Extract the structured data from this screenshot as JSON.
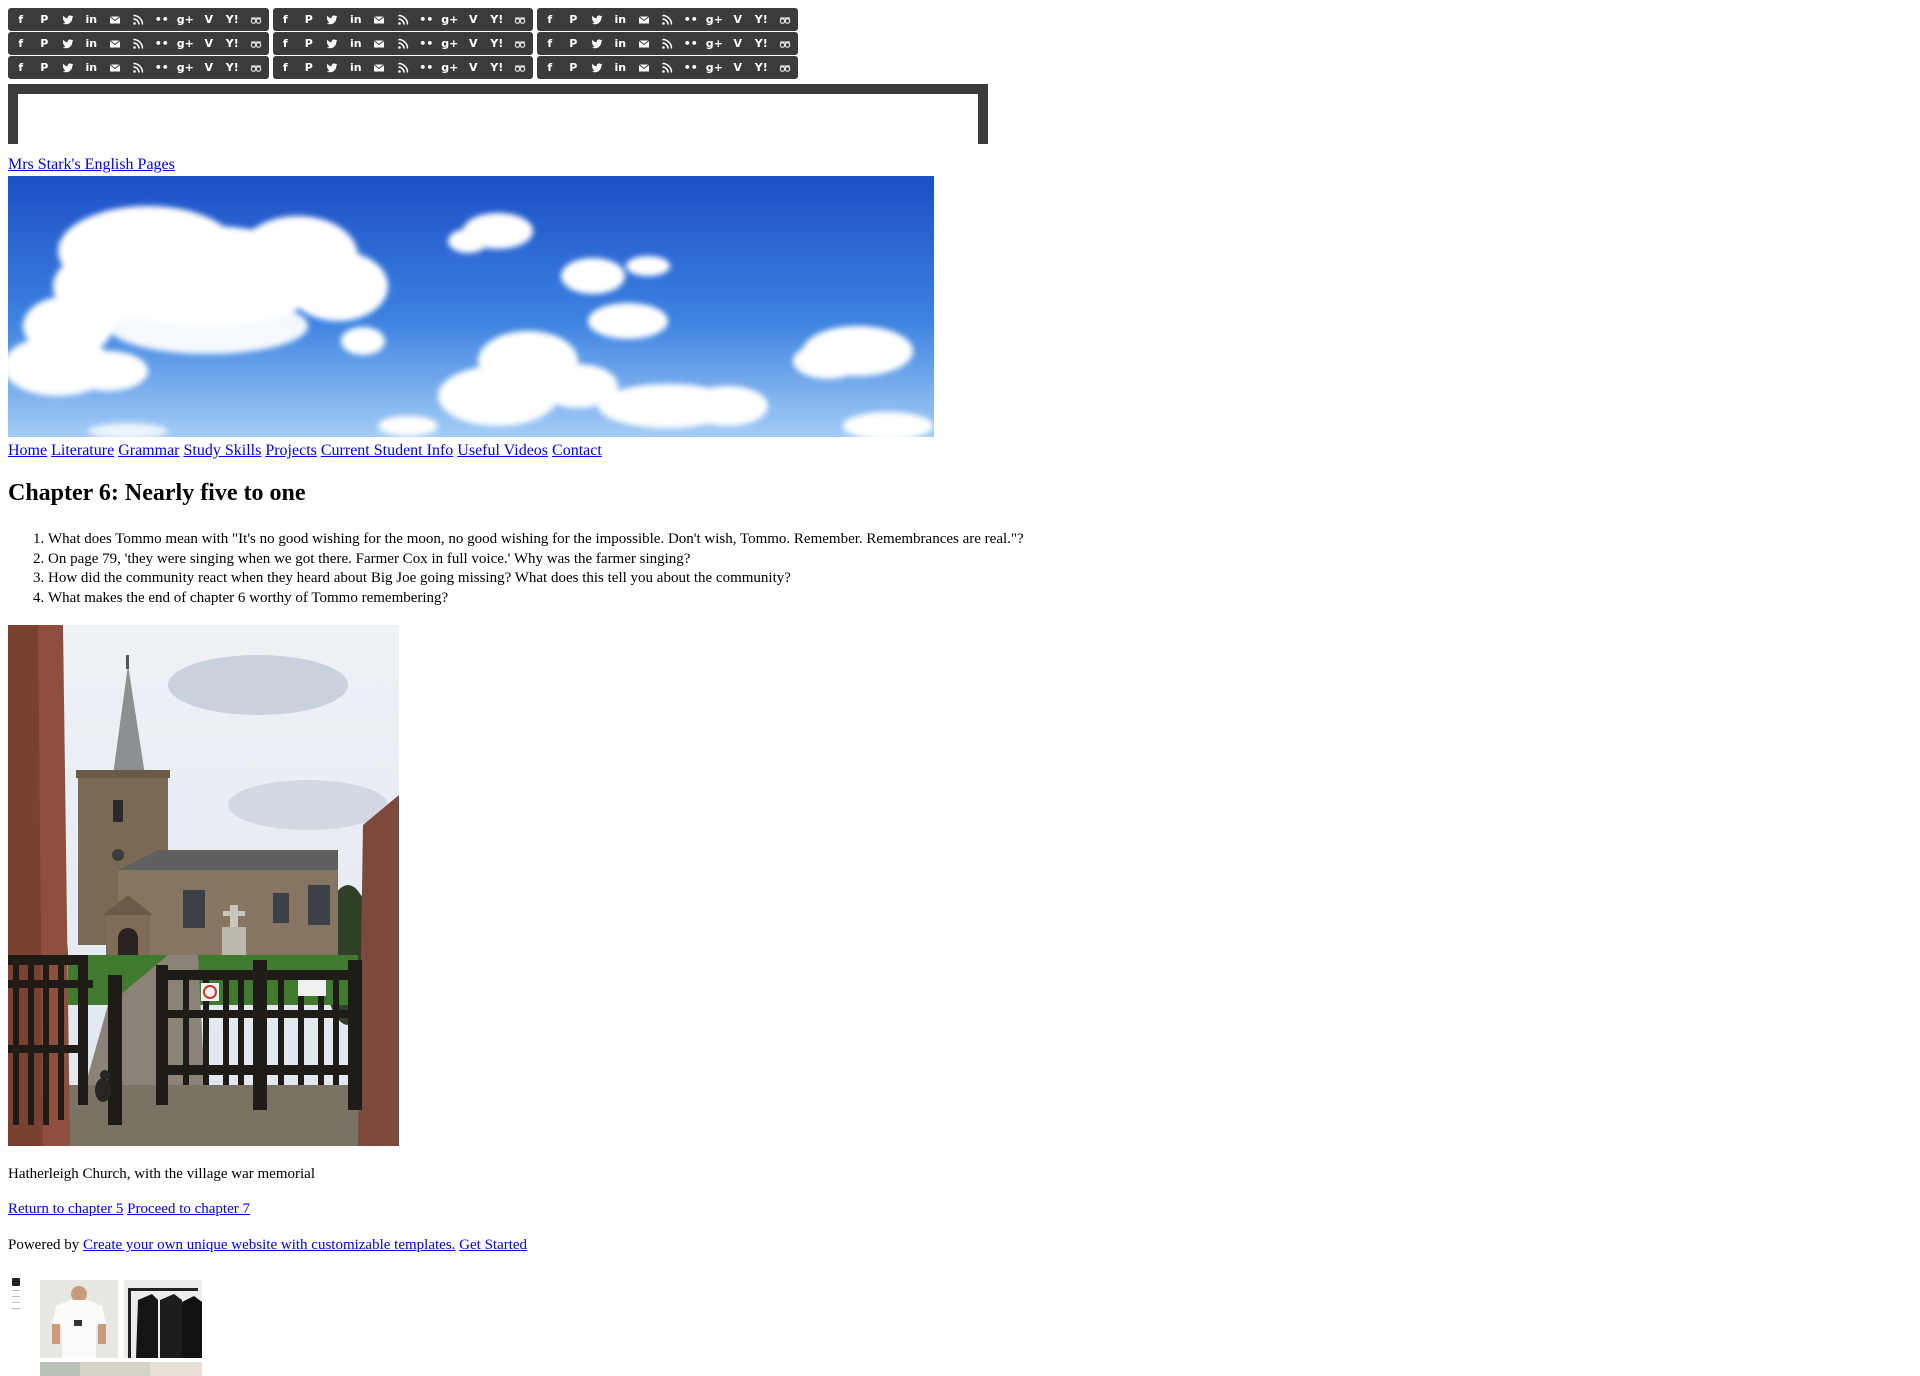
{
  "social": {
    "icons": [
      "facebook-icon",
      "pinterest-icon",
      "twitter-icon",
      "linkedin-icon",
      "mail-icon",
      "rss-icon",
      "flickr-icon",
      "google-plus-icon",
      "vimeo-icon",
      "yahoo-icon",
      "tripadvisor-icon"
    ],
    "glyphs": [
      "f",
      "P",
      "",
      "in",
      "",
      "",
      "••",
      "g+",
      "V",
      "Y!",
      ""
    ]
  },
  "site": {
    "title": "Mrs Stark's English Pages"
  },
  "nav": {
    "items": [
      "Home",
      "Literature",
      "Grammar",
      "Study Skills",
      "Projects",
      "Current Student Info",
      "Useful Videos",
      "Contact"
    ]
  },
  "page": {
    "heading": "Chapter 6: Nearly five to one",
    "questions": [
      "What does Tommo mean with \"It's no good wishing for the moon, no good wishing for the impossible. Don't wish, Tommo. Remember. Remembrances are real.\"?",
      "On page 79, 'they were singing when we got there. Farmer Cox in full voice.' Why was the farmer singing?",
      "How did the community react when they heard about Big Joe going missing? What does this tell you about the community?",
      "What makes the end of chapter 6 worthy of Tommo remembering?"
    ],
    "image_caption": "Hatherleigh Church, with the village war memorial",
    "prev_link": "Return to chapter 5",
    "next_link": "Proceed to chapter 7"
  },
  "footer": {
    "powered_by": "Powered by",
    "create_link": "Create your own unique website with customizable templates.",
    "get_started": "Get Started"
  },
  "colors": {
    "icon_bar": "#3b3b3b",
    "link": "#0000ee",
    "sky_top": "#1d4fc7",
    "sky_bottom": "#9cc6f4"
  }
}
